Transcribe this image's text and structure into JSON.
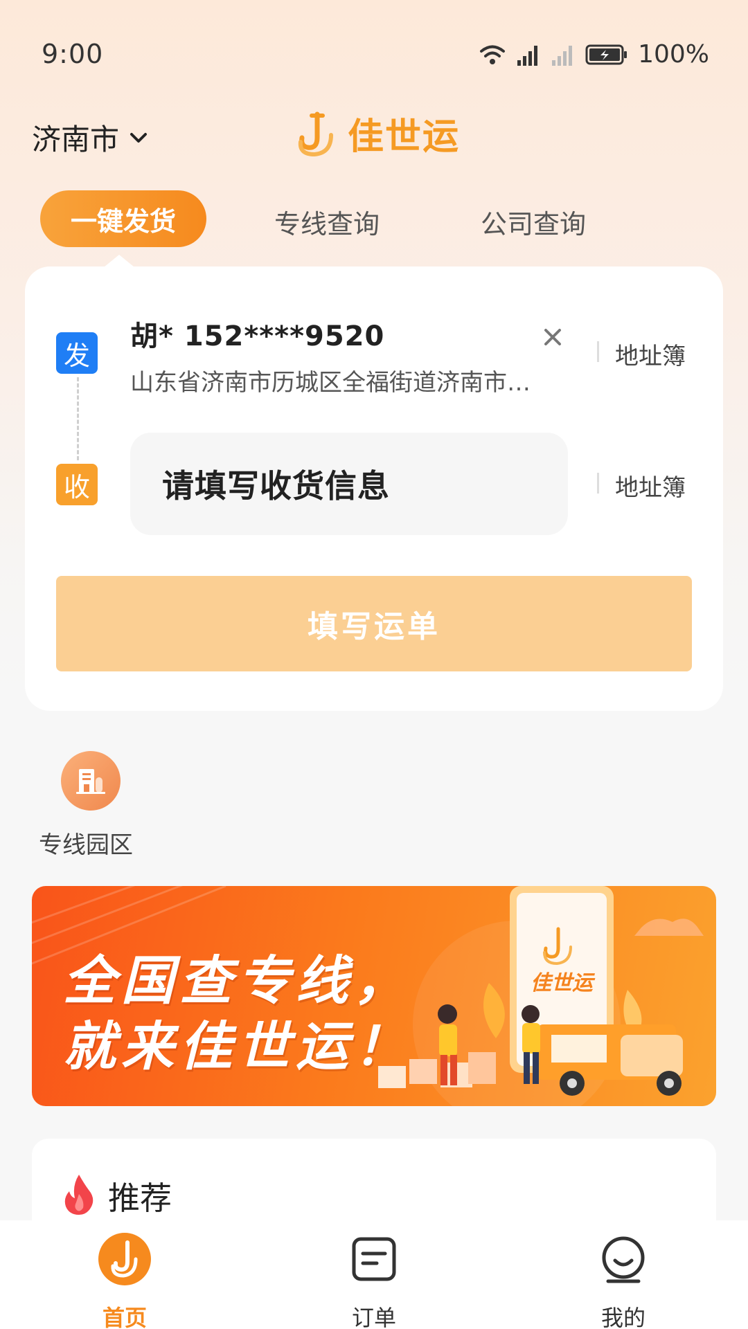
{
  "status_bar": {
    "time": "9:00",
    "battery": "100%",
    "icons": [
      "wifi-icon",
      "signal-icon",
      "signal-icon",
      "battery-charging-icon"
    ]
  },
  "header": {
    "city": "济南市",
    "brand": "佳世运"
  },
  "tabs": [
    {
      "label": "一键发货",
      "active": true
    },
    {
      "label": "专线查询",
      "active": false
    },
    {
      "label": "公司查询",
      "active": false
    }
  ],
  "shipment": {
    "sender_tag": "发",
    "receiver_tag": "收",
    "sender_name": "胡* 152****9520",
    "sender_address": "山东省济南市历城区全福街道济南市…",
    "address_book_label": "地址簿",
    "receiver_placeholder": "请填写收货信息",
    "fill_button": "填写运单"
  },
  "quick_entries": [
    {
      "label": "专线园区",
      "icon": "building-icon"
    }
  ],
  "banner": {
    "line1": "全国查专线，",
    "line2": "就来佳世运！",
    "phone_brand": "佳世运"
  },
  "recommend": {
    "title": "推荐",
    "icon": "flame-icon"
  },
  "tabbar": [
    {
      "label": "首页",
      "icon": "home-logo-icon",
      "active": true
    },
    {
      "label": "订单",
      "icon": "order-icon",
      "active": false
    },
    {
      "label": "我的",
      "icon": "profile-icon",
      "active": false
    }
  ],
  "colors": {
    "accent": "#f68a1e",
    "sender_tag": "#1f7ef5",
    "receiver_tag": "#f8a02c",
    "button_disabled": "#fbcf93"
  }
}
